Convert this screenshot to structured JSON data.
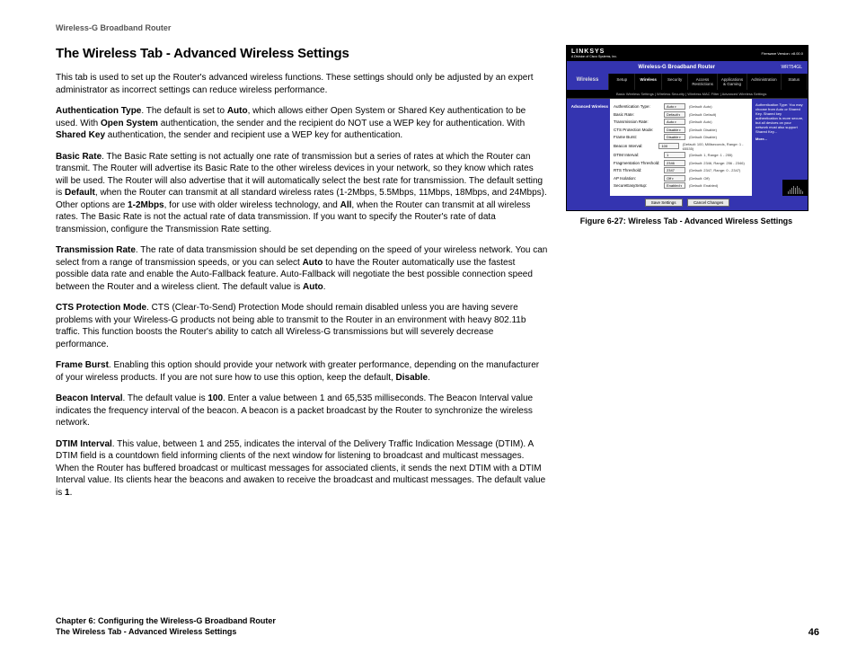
{
  "running_head": "Wireless-G Broadband Router",
  "heading": "The Wireless Tab - Advanced Wireless Settings",
  "intro": "This tab is used to set up the Router's advanced wireless functions. These settings should only be adjusted by an expert administrator as incorrect settings can reduce wireless performance.",
  "paras": {
    "auth": {
      "label": "Authentication Type",
      "t1": ". The default is set to ",
      "b1": "Auto",
      "t2": ", which allows either Open System or Shared Key authentication to be used. With ",
      "b2": "Open System",
      "t3": " authentication, the sender and the recipient do NOT use a WEP key for authentication. With ",
      "b3": "Shared Key",
      "t4": " authentication, the sender and recipient use a WEP key for authentication."
    },
    "basic": {
      "label": "Basic Rate",
      "t1": ". The Basic Rate setting is not actually one rate of transmission but a series of rates at which the Router can transmit. The Router will advertise its Basic Rate to the other wireless devices in your network, so they know which rates will be used. The Router will also advertise that it will automatically select the best rate for transmission. The default setting is ",
      "b1": "Default",
      "t2": ", when the Router can transmit at all standard wireless rates (1-2Mbps, 5.5Mbps, 11Mbps, 18Mbps, and 24Mbps). Other options are ",
      "b2": "1-2Mbps",
      "t3": ", for use with older wireless technology, and ",
      "b3": "All",
      "t4": ", when the Router can transmit at all wireless rates. The Basic Rate is not the actual rate of data transmission. If you want to specify the Router's rate of data transmission, configure the Transmission Rate setting."
    },
    "trans": {
      "label": "Transmission Rate",
      "t1": ". The rate of data transmission should be set depending on the speed of your wireless network. You can select from a range of transmission speeds, or you can select ",
      "b1": "Auto",
      "t2": " to have the Router automatically use the fastest possible data rate and enable the Auto-Fallback feature. Auto-Fallback will negotiate the best possible connection speed between the Router and a wireless client. The default value is ",
      "b2": "Auto",
      "t3": "."
    },
    "cts": {
      "label": "CTS Protection Mode",
      "t1": ". CTS (Clear-To-Send) Protection Mode should remain disabled unless you are having severe problems with your Wireless-G products not being able to transmit to the Router in an environment with heavy 802.11b traffic. This function boosts the Router's ability to catch all Wireless-G transmissions but will severely decrease performance."
    },
    "frame": {
      "label": "Frame Burst",
      "t1": ". Enabling this option should provide your network with greater performance, depending on the manufacturer of your wireless products. If you are not sure how to use this option, keep the default, ",
      "b1": "Disable",
      "t2": "."
    },
    "beacon": {
      "label": "Beacon Interval",
      "t1": ". The default value is ",
      "b1": "100",
      "t2": ". Enter a value between 1 and 65,535 milliseconds. The Beacon Interval value indicates the frequency interval of the beacon. A beacon is a packet broadcast by the Router to synchronize the wireless network."
    },
    "dtim": {
      "label": "DTIM Interval",
      "t1": ". This value, between 1 and 255, indicates the interval of the Delivery Traffic Indication Message (DTIM). A DTIM field is a countdown field informing clients of the next window for listening to broadcast and multicast messages. When the Router has buffered broadcast or multicast messages for associated clients, it sends the next DTIM with a DTIM Interval value. Its clients hear the beacons and awaken to receive the broadcast and multicast messages. The default value is ",
      "b1": "1",
      "t2": "."
    }
  },
  "screenshot": {
    "logo": "LINKSYS",
    "logo_sub": "A Division of Cisco Systems, Inc.",
    "fw": "Firmware Version: v8.00.0",
    "product": "Wireless-G Broadband Router",
    "model": "WRT54GL",
    "sidebar_label": "Wireless",
    "tabs": [
      "Setup",
      "Wireless",
      "Security",
      "Access Restrictions",
      "Applications & Gaming",
      "Administration",
      "Status"
    ],
    "subtabs": "Basic Wireless Settings   |   Wireless Security   |   Wireless MAC Filter   |   Advanced Wireless Settings",
    "section": "Advanced Wireless",
    "rows": [
      {
        "lbl": "Authentication Type:",
        "val": "Auto",
        "sel": true,
        "note": "(Default: Auto)"
      },
      {
        "lbl": "Basic Rate:",
        "val": "Default",
        "sel": true,
        "note": "(Default: Default)"
      },
      {
        "lbl": "Transmission Rate:",
        "val": "Auto",
        "sel": true,
        "note": "(Default: Auto)"
      },
      {
        "lbl": "CTS Protection Mode:",
        "val": "Disable",
        "sel": true,
        "note": "(Default: Disable)"
      },
      {
        "lbl": "Frame Burst:",
        "val": "Disable",
        "sel": true,
        "note": "(Default: Disable)"
      },
      {
        "lbl": "Beacon Interval:",
        "val": "100",
        "sel": false,
        "note": "(Default: 100, Milliseconds, Range: 1 - 65535)"
      },
      {
        "lbl": "DTIM Interval:",
        "val": "1",
        "sel": false,
        "note": "(Default: 1, Range: 1 - 255)"
      },
      {
        "lbl": "Fragmentation Threshold:",
        "val": "2346",
        "sel": false,
        "note": "(Default: 2346, Range: 256 - 2346)"
      },
      {
        "lbl": "RTS Threshold:",
        "val": "2347",
        "sel": false,
        "note": "(Default: 2347, Range: 0 - 2347)"
      },
      {
        "lbl": "AP Isolation:",
        "val": "Off",
        "sel": true,
        "note": "(Default: Off)"
      },
      {
        "lbl": "SecureEasySetup:",
        "val": "Enabled",
        "sel": true,
        "note": "(Default: Enabled)"
      }
    ],
    "help": "Authentication Type: You may choose from Auto or Shared Key. Shared key authentication is more secure, but all devices on your network must also support Shared Key...",
    "more": "More...",
    "save": "Save Settings",
    "cancel": "Cancel Changes"
  },
  "caption": "Figure 6-27: Wireless Tab - Advanced Wireless Settings",
  "footer": {
    "chapter": "Chapter 6: Configuring the Wireless-G Broadband Router",
    "section": "The Wireless Tab - Advanced Wireless Settings",
    "page": "46"
  }
}
